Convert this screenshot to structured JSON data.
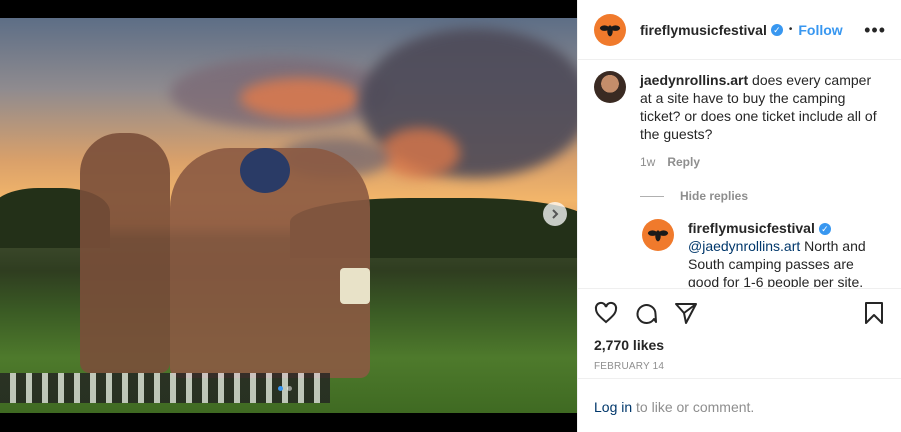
{
  "post": {
    "username": "fireflymusicfestival",
    "follow_label": "Follow",
    "bullet": "•",
    "more_label": "•••"
  },
  "comment": {
    "username": "jaedynrollins.art",
    "text": " does every camper at a site have to buy the camping ticket? or does one ticket include all of the guests?",
    "age": "1w",
    "reply_label": "Reply",
    "hide_replies_label": "Hide replies"
  },
  "reply": {
    "username": "fireflymusicfestival",
    "mention": "@jaedynrollins.art",
    "text": " North and South camping passes are good for 1-6 people per site."
  },
  "stats": {
    "likes": "2,770 likes",
    "date": "FEBRUARY 14"
  },
  "login": {
    "link_label": "Log in",
    "suffix": " to like or comment."
  },
  "carousel": {
    "slide_count": 2,
    "current_slide": 1
  },
  "colors": {
    "accent": "#3897f0",
    "brand_orange": "#f07a2c",
    "link": "#00376b"
  },
  "icons": [
    "heart-icon",
    "comment-icon",
    "share-icon",
    "bookmark-icon",
    "chevron-right-icon",
    "verified-badge-icon",
    "firefly-logo-icon"
  ]
}
